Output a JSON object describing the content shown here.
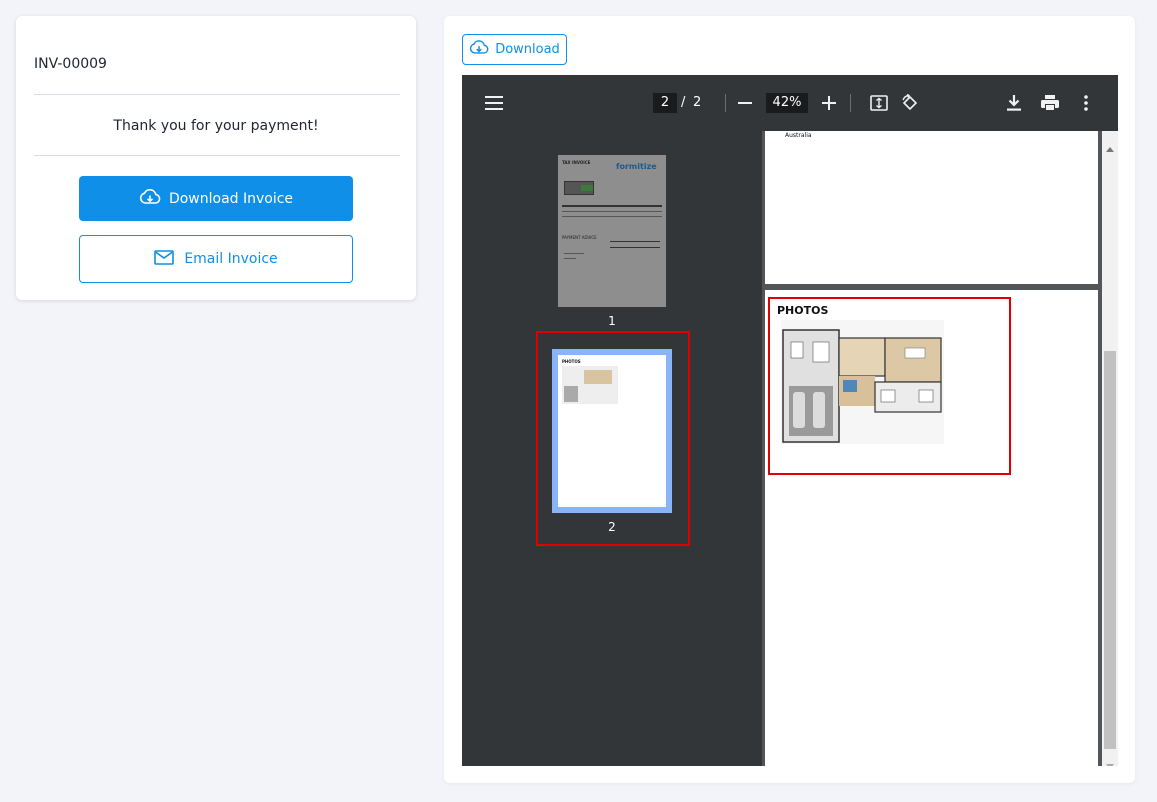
{
  "left_card": {
    "invoice_id": "INV-00009",
    "thank_you": "Thank you for your payment!",
    "download_label": "Download Invoice",
    "email_label": "Email Invoice"
  },
  "right_card": {
    "download_label": "Download"
  },
  "viewer": {
    "current_page": "2",
    "separator": "/",
    "total_pages": "2",
    "zoom": "42%",
    "thumb_labels": [
      "1",
      "2"
    ],
    "page1_text": "Australia",
    "page2_heading": "PHOTOS",
    "thumb1": {
      "header": "TAX INVOICE",
      "brand": "formitize",
      "section": "PAYMENT ADVICE"
    },
    "thumb2": {
      "header": "PHOTOS"
    }
  },
  "colors": {
    "accent": "#0f8fe8",
    "toolbar": "#323639",
    "highlight": "#e00000"
  }
}
